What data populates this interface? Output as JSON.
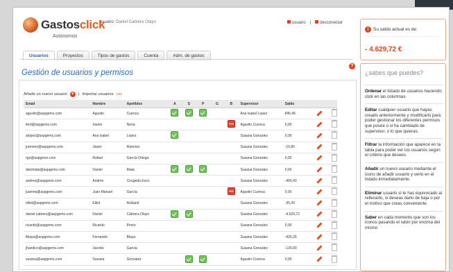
{
  "header": {
    "logo": {
      "main": "Gastos",
      "accent": "click",
      "sub": "Autónomos"
    },
    "user_prefix": "usuario:",
    "user_name": "Daniel Cabrera Olayo",
    "links": [
      "usuario",
      "desconectar"
    ]
  },
  "balance": {
    "label": "Su saldo actual es de:",
    "value": "- 4.629,72 €"
  },
  "tabs": [
    "Usuarios",
    "Proyectos",
    "Tipos de gastos",
    "Cuenta",
    "Adm. de gastos"
  ],
  "page_title": "Gestión de usuarios y permisos",
  "actions": {
    "add_user": "Añadir un nuevo usuario",
    "separator": "|",
    "import_users": "Importar usuarios",
    "csv": "csv"
  },
  "table": {
    "headers": [
      "Email",
      "Nombre",
      "Apellidos",
      "A",
      "S",
      "P",
      "G",
      "B",
      "Supervisor",
      "Saldo"
    ],
    "rows": [
      {
        "email": "aguslin@aspgems.com",
        "name": "Agustin",
        "last": "Cuenca",
        "A": true,
        "S": true,
        "P": true,
        "G": false,
        "B": false,
        "supervisor": "Ana Isabel Lopez",
        "saldo": "845,46"
      },
      {
        "email": "ferd@aspgems.com",
        "name": "Xavier",
        "last": "Noria",
        "A": false,
        "S": false,
        "P": false,
        "G": false,
        "B": true,
        "supervisor": "Agustin Cuenca",
        "saldo": "0,00"
      },
      {
        "email": "alopez@aspgems.com",
        "name": "Ana Isabel",
        "last": "Lopez",
        "A": true,
        "S": false,
        "P": false,
        "G": false,
        "B": false,
        "supervisor": "Susana Gonzalez",
        "saldo": "0,00"
      },
      {
        "email": "jramirez@aspgems.com",
        "name": "Javier",
        "last": "Ramírez",
        "A": false,
        "S": false,
        "P": false,
        "G": false,
        "B": false,
        "supervisor": "Susana Gonzalez",
        "saldo": "-10,80"
      },
      {
        "email": "rgo@aspgems.com",
        "name": "Rafael",
        "last": "García Ortega",
        "A": false,
        "S": false,
        "P": false,
        "G": false,
        "B": false,
        "supervisor": "Susana Gonzalez",
        "saldo": "0,00"
      },
      {
        "email": "danimata@aspgems.com",
        "name": "Daniel",
        "last": "Mata",
        "A": true,
        "S": true,
        "P": true,
        "G": false,
        "B": false,
        "supervisor": "Susana Gonzalez",
        "saldo": "0,00"
      },
      {
        "email": "andres@aspgems.com",
        "name": "Andrés",
        "last": "Cirugeda Esco",
        "A": false,
        "S": false,
        "P": false,
        "G": false,
        "B": false,
        "supervisor": "Susana Gonzalez",
        "saldo": "-466,43"
      },
      {
        "email": "juanma@aspgems.com",
        "name": "Juan Manuel",
        "last": "García",
        "A": false,
        "S": false,
        "P": false,
        "G": false,
        "B": true,
        "supervisor": "Agustin Cuenca",
        "saldo": "0,00"
      },
      {
        "email": "elliot@aspgems.com",
        "name": "Elliot",
        "last": "Ackland",
        "A": false,
        "S": false,
        "P": false,
        "G": false,
        "B": false,
        "supervisor": "Susana Gonzalez",
        "saldo": "-35,43"
      },
      {
        "email": "daniel.cabrera@aspgems.com",
        "name": "Daniel",
        "last": "Cabrera Olayo",
        "A": true,
        "S": true,
        "P": false,
        "G": false,
        "B": false,
        "supervisor": "Susana Gonzalez",
        "saldo": "-4.629,72"
      },
      {
        "email": "ricardo@aspgems.com",
        "name": "Ricardo",
        "last": "Perez",
        "A": false,
        "S": false,
        "P": false,
        "G": false,
        "B": false,
        "supervisor": "Susana Gonzalez",
        "saldo": "0,00"
      },
      {
        "email": "fblaya@aspgems.com",
        "name": "Fernando",
        "last": "Blaya",
        "A": false,
        "S": false,
        "P": false,
        "G": false,
        "B": false,
        "supervisor": "Susana Gonzalez",
        "saldo": "-426,26"
      },
      {
        "email": "jhandico@aspgems.com",
        "name": "Jacobo",
        "last": "García",
        "A": false,
        "S": false,
        "P": false,
        "G": false,
        "B": false,
        "supervisor": "Susana Gonzalez",
        "saldo": "-130,00"
      },
      {
        "email": "susana@aspgems.com",
        "name": "Susana",
        "last": "Gonzalez",
        "A": false,
        "S": true,
        "P": true,
        "G": false,
        "B": false,
        "supervisor": "Agustin Cuenca",
        "saldo": "0,00"
      }
    ]
  },
  "sidebar": {
    "title": "¿sabes que puedes?",
    "tips": [
      {
        "strong": "Ordenar",
        "text": " el listado de usuarios haciendo click en las columnas."
      },
      {
        "strong": "Editar",
        "text": " cualquier usuario que hayas creado anteriormente y modificarlo para poder gestionar los diferentes permisos que posee o si ha cambiado de supervisor, o lo que quieras."
      },
      {
        "strong": "Filtrar",
        "text": " la información que aparece en la tabla para poder ver los usuarios según el criterio que desees."
      },
      {
        "strong": "Añadir",
        "text": " un nuevo usuario mediante el icono de añadir usuario y verlo en el listado inmediatamente."
      },
      {
        "strong": "Eliminar",
        "text": " usuario si te has equivocado al rellenarlo, si deseas darlo de baja o por el motivo que creas conveniente."
      },
      {
        "strong": "Saber",
        "text": " en cada momento que son los iconos pasando el ratón por encima del mismo"
      }
    ]
  },
  "colors": {
    "accent": "#e25c24",
    "title_blue": "#2a6ab8",
    "check_green": "#71c45a",
    "block_red": "#e14c3c"
  }
}
